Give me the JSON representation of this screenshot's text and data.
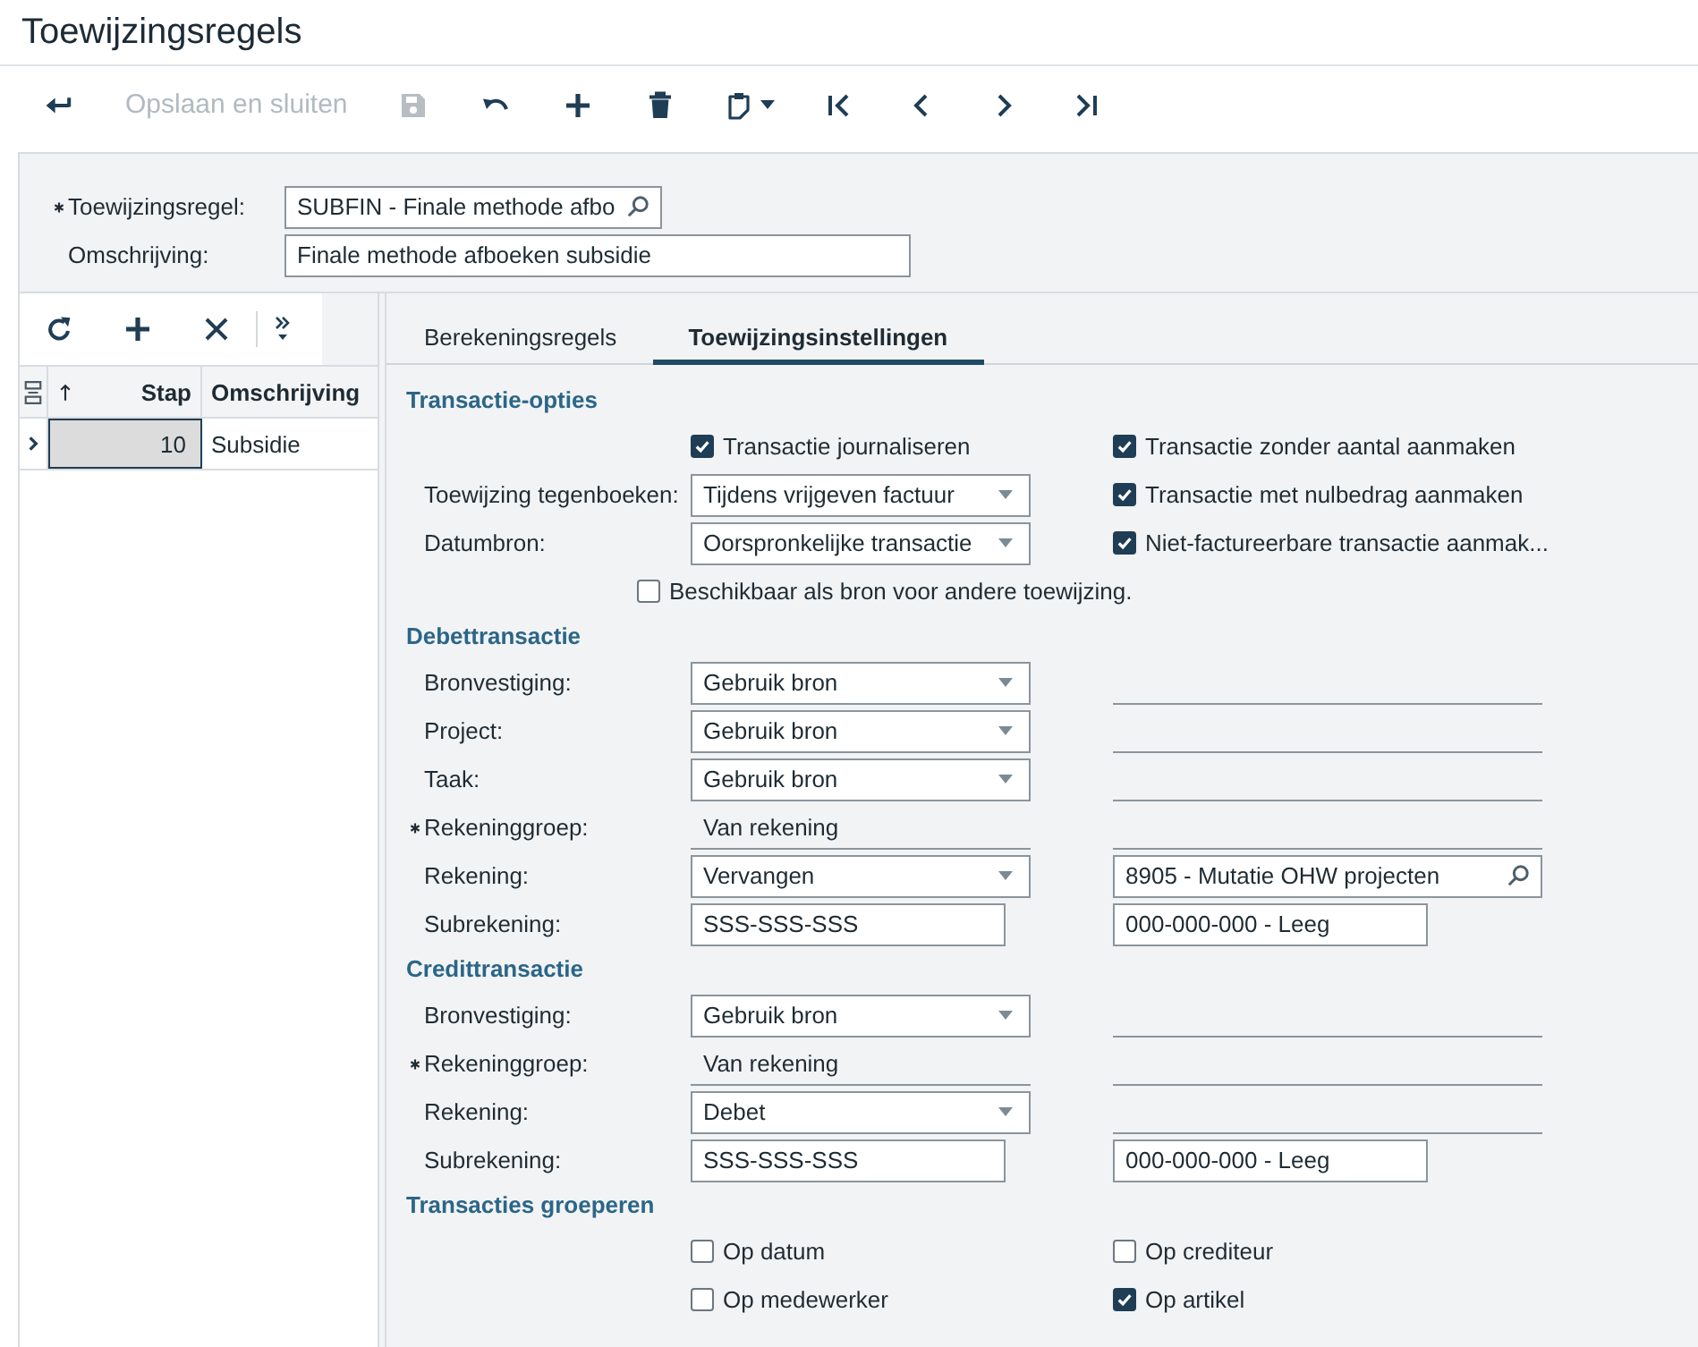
{
  "window": {
    "title": "Toewijzingsregels"
  },
  "toolbar": {
    "save_and_close": {
      "label": "Opslaan en sluiten",
      "disabled": true
    },
    "save": {
      "disabled": true
    }
  },
  "header": {
    "fields": [
      {
        "kind": "lookup",
        "label": "Toewijzingsregel:",
        "required": true,
        "value": "SUBFIN - Finale methode afbo"
      },
      {
        "kind": "text",
        "label": "Omschrijving:",
        "required": false,
        "value": "Finale methode afboeken subsidie"
      }
    ]
  },
  "grid": {
    "columns": [
      {
        "label": "Stap",
        "kind": "number",
        "sorted": true
      },
      {
        "label": "Omschrijving",
        "kind": "text",
        "sorted": false
      }
    ],
    "rows": [
      {
        "selected": true,
        "cells": [
          "10",
          "Subsidie"
        ]
      }
    ]
  },
  "tabs": [
    {
      "label": "Berekeningsregels",
      "selected": false
    },
    {
      "label": "Toewijzingsinstellingen",
      "selected": true
    }
  ],
  "sections": [
    {
      "title": "Transactie-opties",
      "rows": [
        {
          "kind": "field",
          "field": {
            "kind": "checkbox",
            "label": "Transactie journaliseren",
            "checked": true
          },
          "side": {
            "kind": "checkbox",
            "label": "Transactie zonder aantal aanmaken",
            "checked": true
          }
        },
        {
          "kind": "field",
          "label": "Toewijzing tegenboeken:",
          "required": false,
          "field": {
            "kind": "select",
            "value": "Tijdens vrijgeven factuur"
          },
          "side": {
            "kind": "checkbox",
            "label": "Transactie met nulbedrag aanmaken",
            "checked": true
          }
        },
        {
          "kind": "field",
          "label": "Datumbron:",
          "required": false,
          "field": {
            "kind": "select",
            "value": "Oorspronkelijke transactie"
          },
          "side": {
            "kind": "checkbox",
            "label": "Niet-factureerbare transactie aanmak...",
            "checked": true
          }
        },
        {
          "kind": "option",
          "field": {
            "kind": "checkbox",
            "label": "Beschikbaar als bron voor andere toewijzing.",
            "checked": false
          }
        }
      ]
    },
    {
      "title": "Debettransactie",
      "rows": [
        {
          "kind": "field",
          "label": "Bronvestiging:",
          "required": false,
          "field": {
            "kind": "select",
            "value": "Gebruik bron"
          },
          "side": {
            "kind": "blank"
          }
        },
        {
          "kind": "field",
          "label": "Project:",
          "required": false,
          "field": {
            "kind": "select",
            "value": "Gebruik bron"
          },
          "side": {
            "kind": "blank"
          }
        },
        {
          "kind": "field",
          "label": "Taak:",
          "required": false,
          "field": {
            "kind": "select",
            "value": "Gebruik bron"
          },
          "side": {
            "kind": "blank"
          }
        },
        {
          "kind": "field",
          "label": "Rekeninggroep:",
          "required": true,
          "field": {
            "kind": "readonly",
            "value": "Van rekening"
          },
          "side": {
            "kind": "blank"
          }
        },
        {
          "kind": "field",
          "label": "Rekening:",
          "required": false,
          "field": {
            "kind": "select",
            "value": "Vervangen"
          },
          "side": {
            "kind": "lookup",
            "value": "8905 - Mutatie OHW projecten"
          }
        },
        {
          "kind": "field",
          "label": "Subrekening:",
          "required": false,
          "field": {
            "kind": "text",
            "value": "SSS-SSS-SSS"
          },
          "side": {
            "kind": "text",
            "value": "000-000-000 - Leeg"
          }
        }
      ]
    },
    {
      "title": "Credittransactie",
      "rows": [
        {
          "kind": "field",
          "label": "Bronvestiging:",
          "required": false,
          "field": {
            "kind": "select",
            "value": "Gebruik bron"
          },
          "side": {
            "kind": "blank"
          }
        },
        {
          "kind": "field",
          "label": "Rekeninggroep:",
          "required": true,
          "field": {
            "kind": "readonly",
            "value": "Van rekening"
          },
          "side": {
            "kind": "blank"
          }
        },
        {
          "kind": "field",
          "label": "Rekening:",
          "required": false,
          "field": {
            "kind": "select",
            "value": "Debet"
          },
          "side": {
            "kind": "blank"
          }
        },
        {
          "kind": "field",
          "label": "Subrekening:",
          "required": false,
          "field": {
            "kind": "text",
            "value": "SSS-SSS-SSS"
          },
          "side": {
            "kind": "text",
            "value": "000-000-000 - Leeg"
          }
        }
      ]
    },
    {
      "title": "Transacties groeperen",
      "rows": [
        {
          "kind": "field",
          "field": {
            "kind": "checkbox",
            "label": "Op datum",
            "checked": false
          },
          "side": {
            "kind": "checkbox",
            "label": "Op crediteur",
            "checked": false
          }
        },
        {
          "kind": "field",
          "field": {
            "kind": "checkbox",
            "label": "Op medewerker",
            "checked": false
          },
          "side": {
            "kind": "checkbox",
            "label": "Op artikel",
            "checked": true
          }
        }
      ]
    }
  ]
}
